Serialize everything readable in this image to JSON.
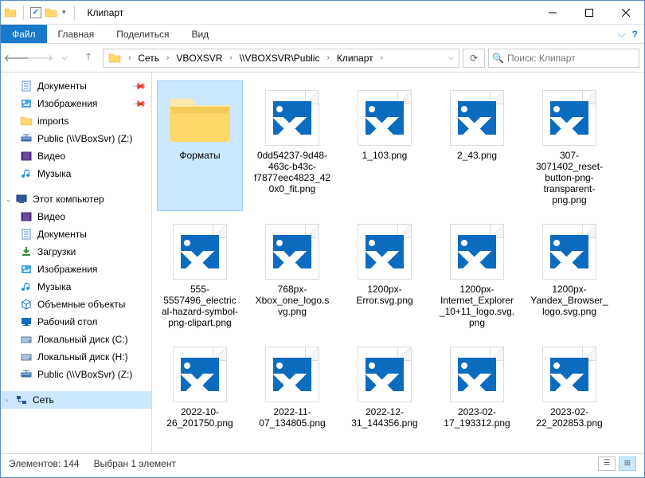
{
  "title": "Клипарт",
  "ribbon": {
    "file": "Файл",
    "home": "Главная",
    "share": "Поделиться",
    "view": "Вид"
  },
  "breadcrumb": [
    "Сеть",
    "VBOXSVR",
    "\\\\VBOXSVR\\Public",
    "Клипарт"
  ],
  "search_placeholder": "Поиск: Клипарт",
  "sidebar": {
    "quick": [
      {
        "label": "Документы",
        "pin": true,
        "icon": "doc"
      },
      {
        "label": "Изображения",
        "pin": true,
        "icon": "img"
      },
      {
        "label": "imports",
        "pin": false,
        "icon": "fold"
      },
      {
        "label": "Public (\\\\VBoxSvr) (Z:)",
        "pin": false,
        "icon": "net"
      }
    ],
    "quick2": [
      {
        "label": "Видео",
        "icon": "vid"
      },
      {
        "label": "Музыка",
        "icon": "mus"
      }
    ],
    "thispc_label": "Этот компьютер",
    "thispc": [
      {
        "label": "Видео",
        "icon": "vid"
      },
      {
        "label": "Документы",
        "icon": "doc"
      },
      {
        "label": "Загрузки",
        "icon": "dl"
      },
      {
        "label": "Изображения",
        "icon": "img"
      },
      {
        "label": "Музыка",
        "icon": "mus"
      },
      {
        "label": "Объемные объекты",
        "icon": "3d"
      },
      {
        "label": "Рабочий стол",
        "icon": "desk"
      },
      {
        "label": "Локальный диск (C:)",
        "icon": "hdd"
      },
      {
        "label": "Локальный диск (H:)",
        "icon": "hdd"
      },
      {
        "label": "Public (\\\\VBoxSvr) (Z:)",
        "icon": "net"
      }
    ],
    "network_label": "Сеть"
  },
  "items": [
    {
      "name": "Форматы",
      "type": "folder",
      "selected": true
    },
    {
      "name": "0dd54237-9d48-463c-b43c-f7877eec4823_420x0_fit.png",
      "type": "image"
    },
    {
      "name": "1_103.png",
      "type": "image"
    },
    {
      "name": "2_43.png",
      "type": "image"
    },
    {
      "name": "307-3071402_reset-button-png-transparent-png.png",
      "type": "image"
    },
    {
      "name": "555-5557496_electrical-hazard-symbol-png-clipart.png",
      "type": "image"
    },
    {
      "name": "768px-Xbox_one_logo.svg.png",
      "type": "image"
    },
    {
      "name": "1200px-Error.svg.png",
      "type": "image"
    },
    {
      "name": "1200px-Internet_Explorer_10+11_logo.svg.png",
      "type": "image"
    },
    {
      "name": "1200px-Yandex_Browser_logo.svg.png",
      "type": "image"
    },
    {
      "name": "2022-10-26_201750.png",
      "type": "image"
    },
    {
      "name": "2022-11-07_134805.png",
      "type": "image"
    },
    {
      "name": "2022-12-31_144356.png",
      "type": "image"
    },
    {
      "name": "2023-02-17_193312.png",
      "type": "image"
    },
    {
      "name": "2023-02-22_202853.png",
      "type": "image"
    }
  ],
  "status": {
    "count_label": "Элементов: 144",
    "sel_label": "Выбран 1 элемент"
  }
}
